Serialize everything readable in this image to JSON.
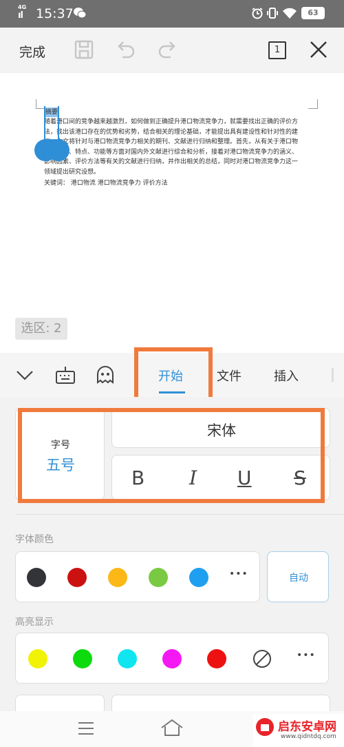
{
  "status": {
    "network": "4G",
    "signal": "ıl",
    "time": "15:37",
    "wechat_icon": "wechat-icon",
    "battery": "63"
  },
  "toolbar": {
    "done": "完成",
    "page_num": "1"
  },
  "document": {
    "heading": "摘要",
    "lines": [
      "随着港口间的竞争越来越激烈，如何做到正确提升港口物流竞争力，就需要找出正确的评价方",
      "法，找出该港口存在的优势和劣势，结合相关的理论基础，才能提出具有建设性和针对性的建",
      "议。本文将针对与港口物流竞争力相关的期刊、文献进行归纳和整理。首先，从有关于港口物",
      "流的定义、特点、功能等方面对国内外文献进行综合和分析，接着对港口物流竞争力的涵义、",
      "影响因素、评价方法等有关的文献进行归纳，并作出相关的总结，同时对港口物流竞争力这一",
      "领域提出研究设想。"
    ],
    "keywords": "关键词：  港口物流  港口物流竞争力    评价方法"
  },
  "selection": "选区: 2",
  "tabs": [
    "开始",
    "文件",
    "插入"
  ],
  "font": {
    "size_label": "字号",
    "size_value": "五号",
    "family": "宋体",
    "bold": "B",
    "italic": "I",
    "underline": "U",
    "strike": "S"
  },
  "font_color": {
    "label": "字体颜色",
    "colors": [
      "#333438",
      "#cc1111",
      "#fbb817",
      "#7ac943",
      "#1f9ff0"
    ],
    "more": "•••",
    "auto": "自动"
  },
  "highlight": {
    "label": "高亮显示",
    "colors": [
      "#f2f205",
      "#0ddb0d",
      "#10e5f0",
      "#f518f5",
      "#ee1111"
    ],
    "more": "•••"
  },
  "watermark": "启东安卓网",
  "watermark_url": "www.qidntdq.com",
  "accent": "#2f8fd6",
  "annotation_color": "#f07a3c"
}
